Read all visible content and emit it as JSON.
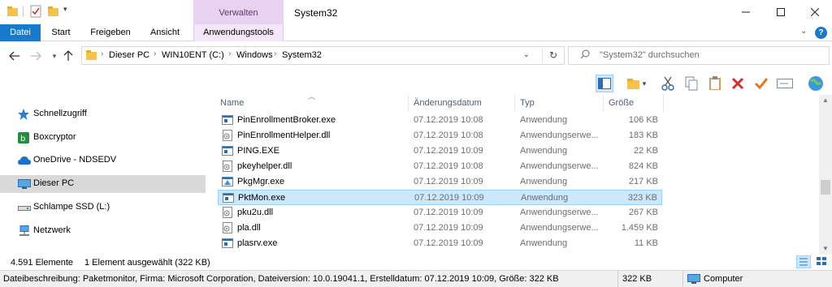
{
  "titlebar": {
    "context_group": "Verwalten",
    "window_title": "System32"
  },
  "ribbon": {
    "tabs": [
      "Datei",
      "Start",
      "Freigeben",
      "Ansicht"
    ],
    "context_tab": "Anwendungstools"
  },
  "address": {
    "crumbs": [
      "Dieser PC",
      "WIN10ENT (C:)",
      "Windows",
      "System32"
    ],
    "search_placeholder": "\"System32\" durchsuchen"
  },
  "nav": {
    "items": [
      {
        "label": "Schnellzugriff",
        "icon": "star-icon"
      },
      {
        "label": "Boxcryptor",
        "icon": "boxcryptor-icon"
      },
      {
        "label": "OneDrive - NDSEDV",
        "icon": "cloud-icon"
      },
      {
        "label": "Dieser PC",
        "icon": "computer-icon"
      },
      {
        "label": "Schlampe SSD (L:)",
        "icon": "drive-icon"
      },
      {
        "label": "Netzwerk",
        "icon": "network-icon"
      }
    ]
  },
  "columns": {
    "name": "Name",
    "date": "Änderungsdatum",
    "type": "Typ",
    "size": "Größe"
  },
  "files": [
    {
      "name": "PinEnrollmentBroker.exe",
      "date": "07.12.2019 10:08",
      "type": "Anwendung",
      "size": "106 KB",
      "icon": "exe-icon"
    },
    {
      "name": "PinEnrollmentHelper.dll",
      "date": "07.12.2019 10:08",
      "type": "Anwendungserwe...",
      "size": "183 KB",
      "icon": "dll-icon"
    },
    {
      "name": "PING.EXE",
      "date": "07.12.2019 10:09",
      "type": "Anwendung",
      "size": "22 KB",
      "icon": "exe-icon"
    },
    {
      "name": "pkeyhelper.dll",
      "date": "07.12.2019 10:08",
      "type": "Anwendungserwe...",
      "size": "824 KB",
      "icon": "dll-icon"
    },
    {
      "name": "PkgMgr.exe",
      "date": "07.12.2019 10:09",
      "type": "Anwendung",
      "size": "217 KB",
      "icon": "exe-icon"
    },
    {
      "name": "PktMon.exe",
      "date": "07.12.2019 10:09",
      "type": "Anwendung",
      "size": "323 KB",
      "icon": "exe-icon"
    },
    {
      "name": "pku2u.dll",
      "date": "07.12.2019 10:09",
      "type": "Anwendungserwe...",
      "size": "267 KB",
      "icon": "dll-icon"
    },
    {
      "name": "pla.dll",
      "date": "07.12.2019 10:09",
      "type": "Anwendungserwe...",
      "size": "1.459 KB",
      "icon": "dll-icon"
    },
    {
      "name": "plasrv.exe",
      "date": "07.12.2019 10:09",
      "type": "Anwendung",
      "size": "11 KB",
      "icon": "exe-icon"
    }
  ],
  "selected_file": "PktMon.exe",
  "status": {
    "count": "4.591 Elemente",
    "selection": "1 Element ausgewählt (322 KB)"
  },
  "details": {
    "description": "Dateibeschreibung: Paketmonitor, Firma: Microsoft Corporation, Dateiversion: 10.0.19041.1, Erstelldatum: 07.12.2019 10:09, Größe: 322 KB",
    "size": "322 KB",
    "location": "Computer"
  },
  "colors": {
    "accent": "#1979ca",
    "selection": "#cce8ff",
    "context": "#e7d3f1"
  }
}
